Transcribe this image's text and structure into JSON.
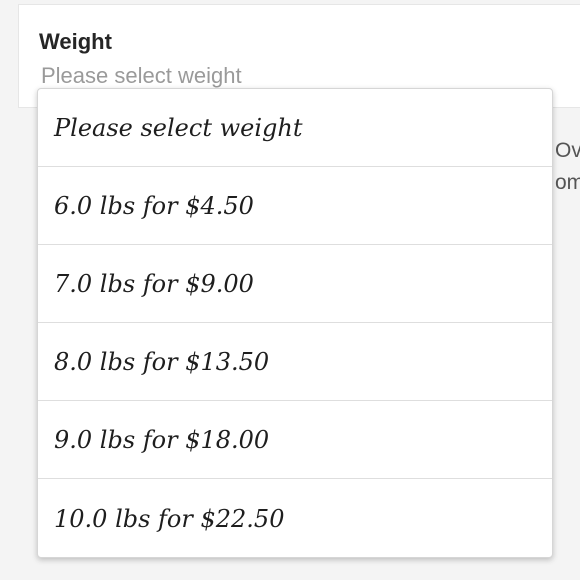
{
  "field": {
    "label": "Weight",
    "placeholder": "Please select weight"
  },
  "side": {
    "line1": "Ov",
    "line2": "om"
  },
  "dropdown": {
    "options": [
      "Please select weight",
      "6.0 lbs for $4.50",
      "7.0 lbs for $9.00",
      "8.0 lbs for $13.50",
      "9.0 lbs for $18.00",
      "10.0 lbs for $22.50"
    ]
  }
}
